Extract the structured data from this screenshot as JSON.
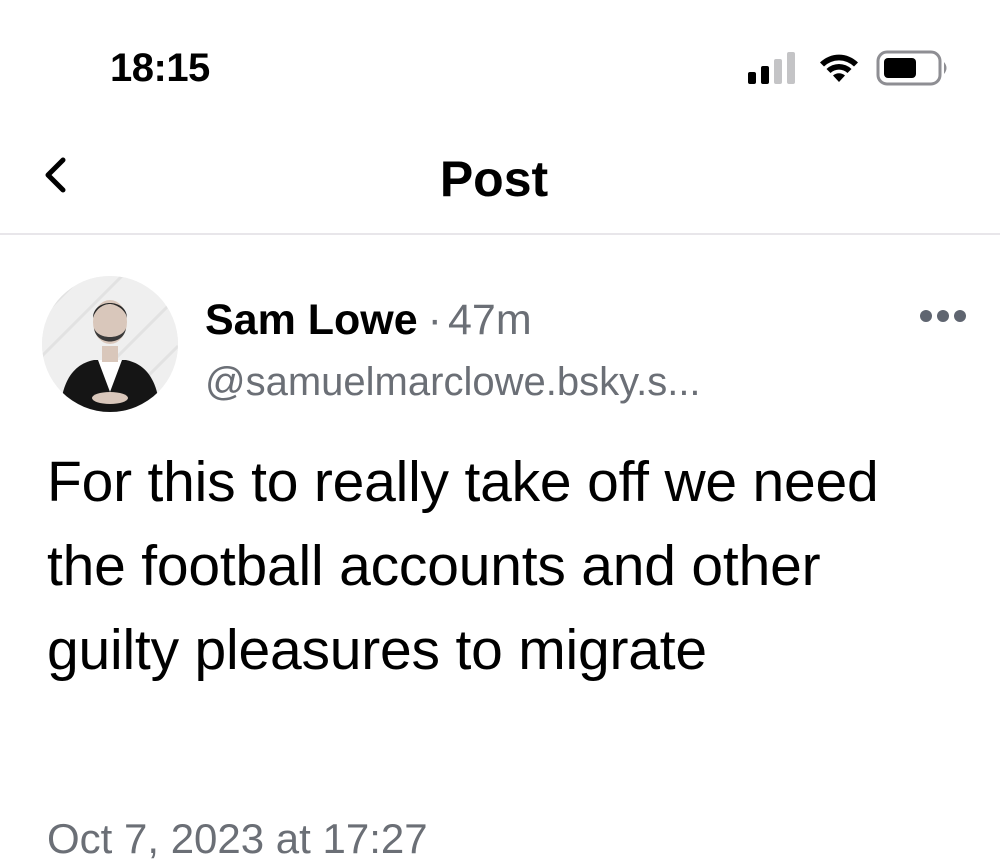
{
  "status_bar": {
    "time": "18:15",
    "icons": [
      "cellular-signal-icon",
      "wifi-icon",
      "battery-icon"
    ]
  },
  "nav": {
    "title": "Post",
    "back_icon": "chevron-left-icon"
  },
  "post": {
    "author_name": "Sam Lowe",
    "separator": "·",
    "time_ago": "47m",
    "handle": "@samuelmarclowe.bsky.s...",
    "more_icon": "more-horizontal-icon",
    "text": "For this to really take off we need the football accounts and other guilty pleasures to migrate",
    "date": "Oct 7, 2023 at 17:27"
  },
  "colors": {
    "text": "#000000",
    "secondary_text": "#6b6f76",
    "divider": "#e8e6ea",
    "background": "#ffffff"
  }
}
